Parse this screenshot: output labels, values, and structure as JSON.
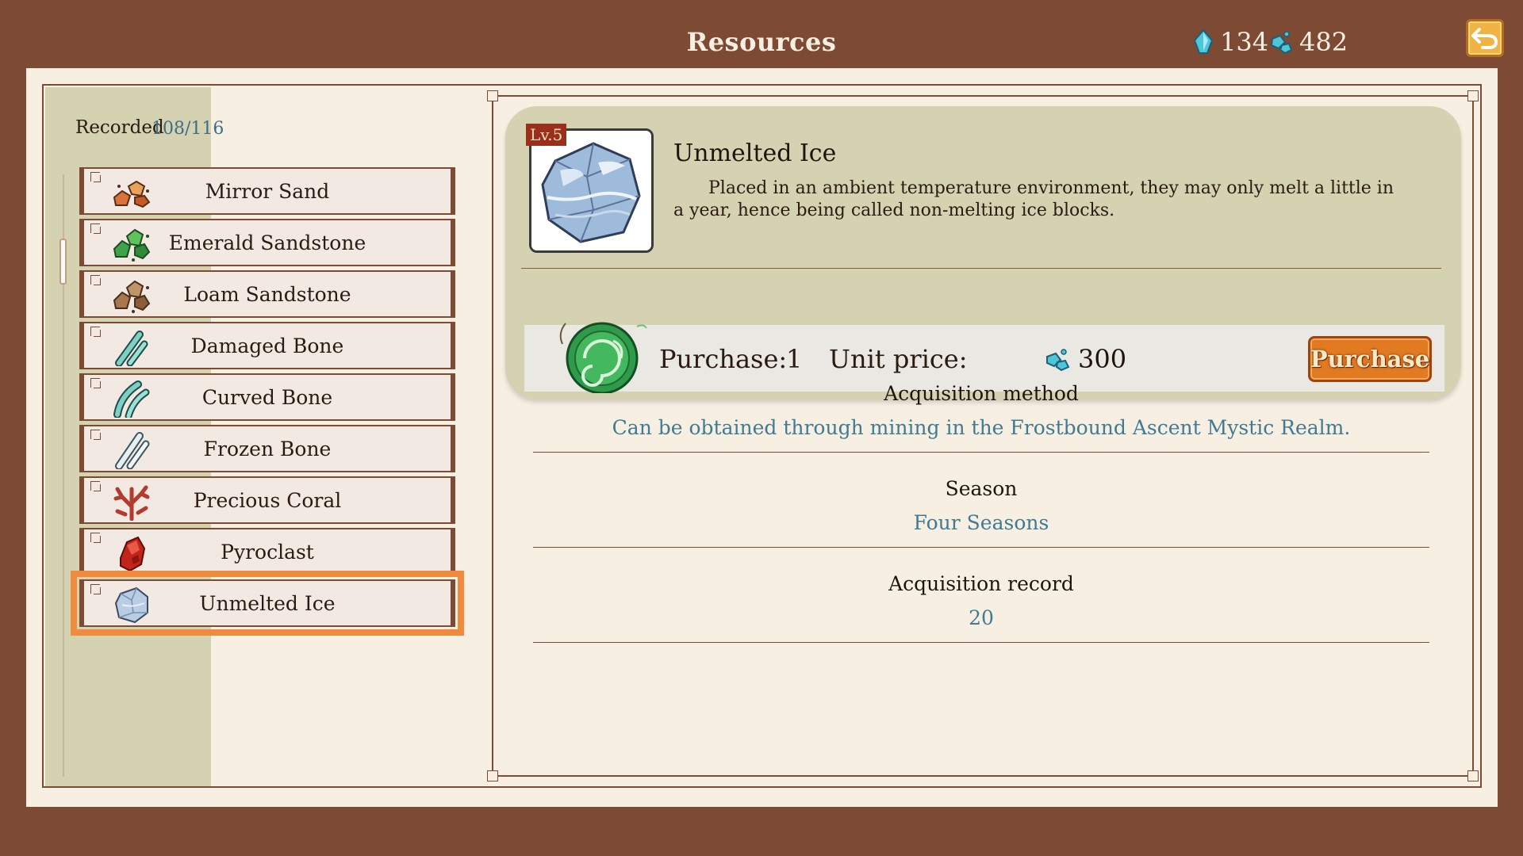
{
  "header": {
    "title": "Resources",
    "currency_primary": "134",
    "currency_secondary": "482"
  },
  "sidebar": {
    "recorded_label": "Recorded",
    "recorded_count": "108/116",
    "items": [
      {
        "label": "Mirror Sand",
        "icon": "mirror-sand-icon"
      },
      {
        "label": "Emerald Sandstone",
        "icon": "emerald-sandstone-icon"
      },
      {
        "label": "Loam Sandstone",
        "icon": "loam-sandstone-icon"
      },
      {
        "label": "Damaged Bone",
        "icon": "damaged-bone-icon"
      },
      {
        "label": "Curved Bone",
        "icon": "curved-bone-icon"
      },
      {
        "label": "Frozen Bone",
        "icon": "frozen-bone-icon"
      },
      {
        "label": "Precious Coral",
        "icon": "precious-coral-icon"
      },
      {
        "label": "Pyroclast",
        "icon": "pyroclast-icon"
      },
      {
        "label": "Unmelted Ice",
        "icon": "unmelted-ice-icon",
        "selected": true
      }
    ]
  },
  "detail": {
    "level": "Lv.5",
    "name": "Unmelted Ice",
    "description": "Placed in an ambient temperature environment, they may only melt a little in a year, hence being called non-melting ice blocks.",
    "purchase_label": "Purchase:",
    "purchase_qty": "1",
    "unit_price_label": "Unit price:",
    "unit_price": "300",
    "purchase_button": "Purchase"
  },
  "info": {
    "acquisition_method_title": "Acquisition method",
    "acquisition_method_value": "Can be obtained through mining in the Frostbound Ascent Mystic Realm.",
    "season_title": "Season",
    "season_value": "Four Seasons",
    "record_title": "Acquisition record",
    "record_value": "20"
  },
  "colors": {
    "frame_brown": "#7d4a33",
    "panel_cream": "#f8efe3",
    "sage": "#d4d2b0",
    "highlight_orange": "#f08a3c",
    "link_blue": "#3f7b93"
  }
}
